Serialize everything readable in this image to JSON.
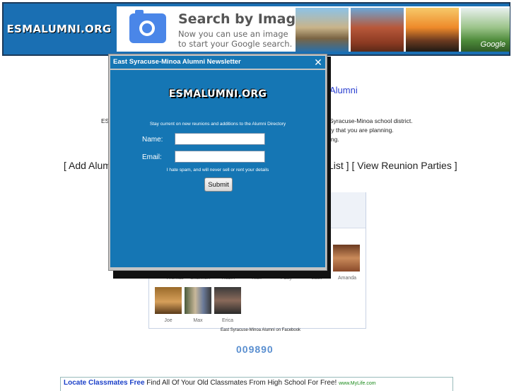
{
  "header": {
    "logo": "ESMALUMNI.ORG",
    "ad": {
      "title": "Search by Image",
      "line1": "Now you can use an image",
      "line2": "to start your Google search.",
      "brand": "Google"
    }
  },
  "background": {
    "title_fragment": "Alumni",
    "intro_left": "ES",
    "intro_right_1": "Syracuse-Minoa school district.",
    "intro_right_2": "ty that you are planning.",
    "intro_right_3": "ing.",
    "nav_left": "[ Add Alum",
    "nav_right": "List ] [ View Reunion Parties ]",
    "faces_row1": [
      {
        "name": "Thomas"
      },
      {
        "name": "Shannon"
      },
      {
        "name": "Robin"
      },
      {
        "name": "Rick"
      },
      {
        "name": "Patty"
      },
      {
        "name": "Jack"
      },
      {
        "name": "Amanda"
      }
    ],
    "faces_row2": [
      {
        "name": "Joe"
      },
      {
        "name": "Max"
      },
      {
        "name": "Erica"
      }
    ],
    "facebook_caption": "East Syracuse-Minoa Alumni on Facebook",
    "counter": "009890",
    "bottom_ad": {
      "link": "Locate Classmates Free",
      "text": "Find All Of Your Old Classmates From High School For Free!",
      "url": "www.MyLife.com"
    }
  },
  "modal": {
    "title": "East Syracuse-Minoa Alumni Newsletter",
    "logo": "ESMALUMNI.ORG",
    "intro": "Stay current on new reunions and additions to the Alumni Directory",
    "name_label": "Name:",
    "name_value": "",
    "email_label": "Email:",
    "email_value": "",
    "spam_note": "I hate spam, and will never sell or rent your details",
    "submit_label": "Submit"
  }
}
